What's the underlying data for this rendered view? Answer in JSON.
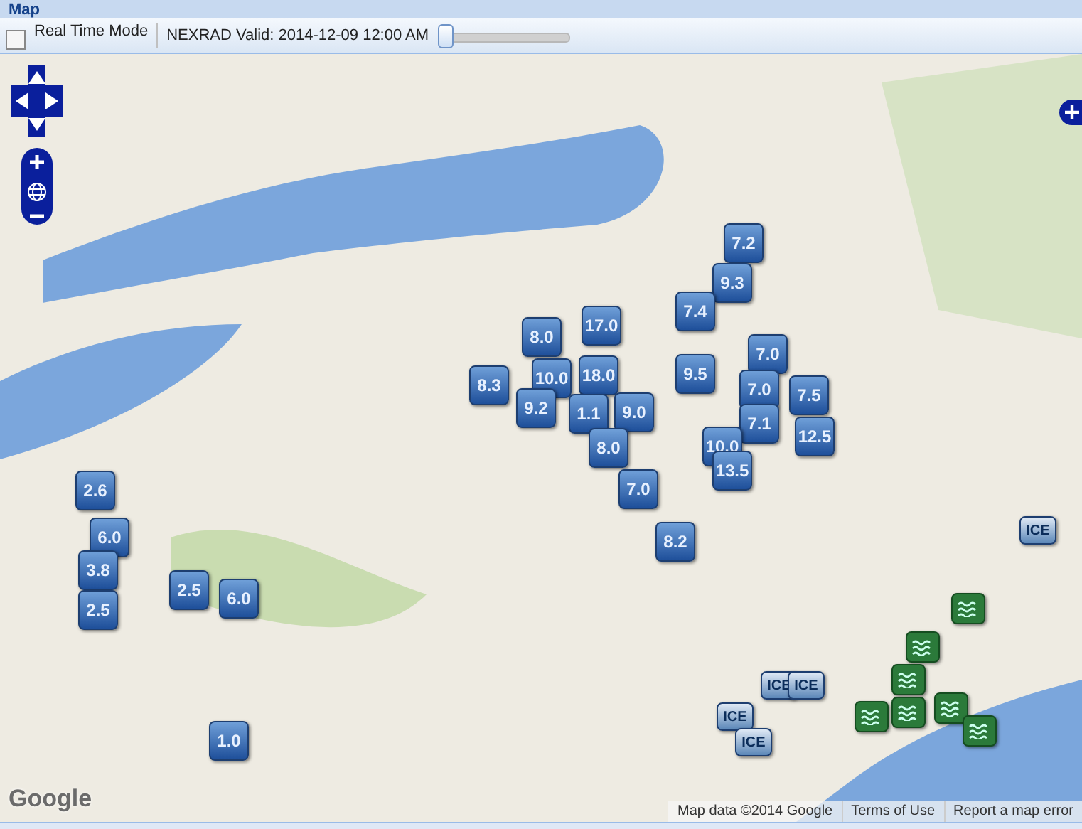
{
  "panel": {
    "title": "Map"
  },
  "toolbar": {
    "real_time_mode": {
      "label": "Real Time Mode",
      "checked": false
    },
    "nexrad_label": "NEXRAD Valid: 2014-12-09 12:00 AM",
    "time_slider": {
      "level": 0
    }
  },
  "map": {
    "markers": [
      {
        "kind": "snow",
        "label": "7.2"
      },
      {
        "kind": "snow",
        "label": "9.3"
      },
      {
        "kind": "snow",
        "label": "7.4"
      },
      {
        "kind": "snow",
        "label": "17.0"
      },
      {
        "kind": "snow",
        "label": "8.0"
      },
      {
        "kind": "snow",
        "label": "7.0"
      },
      {
        "kind": "snow",
        "label": "8.3"
      },
      {
        "kind": "snow",
        "label": "10.0"
      },
      {
        "kind": "snow",
        "label": "18.0"
      },
      {
        "kind": "snow",
        "label": "9.5"
      },
      {
        "kind": "snow",
        "label": "7.0"
      },
      {
        "kind": "snow",
        "label": "7.5"
      },
      {
        "kind": "snow",
        "label": "9.2"
      },
      {
        "kind": "snow",
        "label": "1.1"
      },
      {
        "kind": "snow",
        "label": "9.0"
      },
      {
        "kind": "snow",
        "label": "7.1"
      },
      {
        "kind": "snow",
        "label": "12.5"
      },
      {
        "kind": "snow",
        "label": "8.0"
      },
      {
        "kind": "snow",
        "label": "10.0"
      },
      {
        "kind": "snow",
        "label": "13.5"
      },
      {
        "kind": "snow",
        "label": "7.0"
      },
      {
        "kind": "snow",
        "label": "8.2"
      },
      {
        "kind": "snow",
        "label": "2.6"
      },
      {
        "kind": "snow",
        "label": "6.0"
      },
      {
        "kind": "snow",
        "label": "3.8"
      },
      {
        "kind": "snow",
        "label": "2.5"
      },
      {
        "kind": "snow",
        "label": "6.0"
      },
      {
        "kind": "snow",
        "label": "2.5"
      },
      {
        "kind": "snow",
        "label": "1.0"
      },
      {
        "kind": "ice",
        "label": "ICE"
      },
      {
        "kind": "ice",
        "label": "ICE"
      },
      {
        "kind": "ice",
        "label": "ICE"
      },
      {
        "kind": "ice",
        "label": "ICE"
      },
      {
        "kind": "ice",
        "label": "ICE"
      },
      {
        "kind": "flood"
      },
      {
        "kind": "flood"
      },
      {
        "kind": "flood"
      },
      {
        "kind": "flood"
      },
      {
        "kind": "flood"
      },
      {
        "kind": "flood"
      },
      {
        "kind": "flood"
      }
    ],
    "logo": "Google",
    "data_credit": "Map data ©2014 Google",
    "terms": "Terms of Use",
    "report": "Report a map error"
  }
}
